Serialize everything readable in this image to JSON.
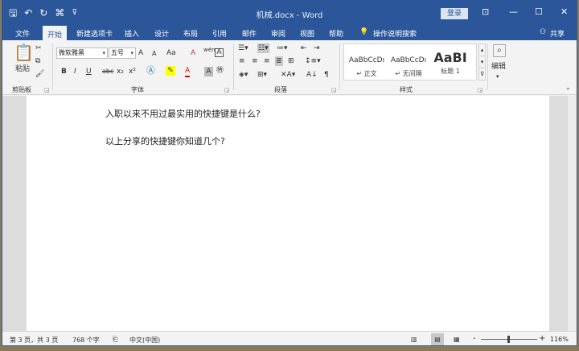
{
  "window": {
    "doc_title": "机械.docx - Word",
    "login_label": "登录",
    "ctrl_restore": "⊡",
    "ctrl_min": "—",
    "ctrl_max": "☐",
    "ctrl_close": "✕"
  },
  "qat": {
    "save": "🖫",
    "undo": "↶",
    "redo": "↻",
    "touch": "⌘",
    "more": "⊽"
  },
  "tabs": [
    "文件",
    "开始",
    "新建选项卡",
    "插入",
    "设计",
    "布局",
    "引用",
    "邮件",
    "审阅",
    "视图",
    "帮助"
  ],
  "tell_me": "操作说明搜索",
  "share": "共享",
  "ribbon": {
    "clipboard": {
      "paste": "粘贴",
      "label": "剪贴板"
    },
    "font": {
      "font_name": "微软雅黑",
      "font_size": "五号",
      "grow": "A",
      "shrink": "A",
      "case": "Aa",
      "clear": "A",
      "phonetic": "wén",
      "bold": "B",
      "italic": "I",
      "underline": "U",
      "strike": "abc",
      "subscript": "x₂",
      "superscript": "x²",
      "label": "字体"
    },
    "paragraph": {
      "label": "段落"
    },
    "styles": {
      "items": [
        {
          "sample": "AaBbCcDı",
          "name": "↵ 正文"
        },
        {
          "sample": "AaBbCcDı",
          "name": "↵ 无间隔"
        },
        {
          "sample": "AaBI",
          "name": "标题 1"
        }
      ],
      "label": "样式"
    },
    "editing": {
      "label": "编辑"
    }
  },
  "document": {
    "lines": [
      "入职以来不用过最实用的快捷键是什么?",
      "以上分享的快捷键你知道几个?"
    ]
  },
  "status": {
    "page": "第 3 页，共 3 页",
    "words": "768 个字",
    "lang": "中文(中国)",
    "zoom": "116%",
    "zoom_minus": "-",
    "zoom_plus": "+"
  },
  "colors": {
    "accent": "#2b579a",
    "highlight": "#ffff00",
    "font_color": "#e00000"
  }
}
